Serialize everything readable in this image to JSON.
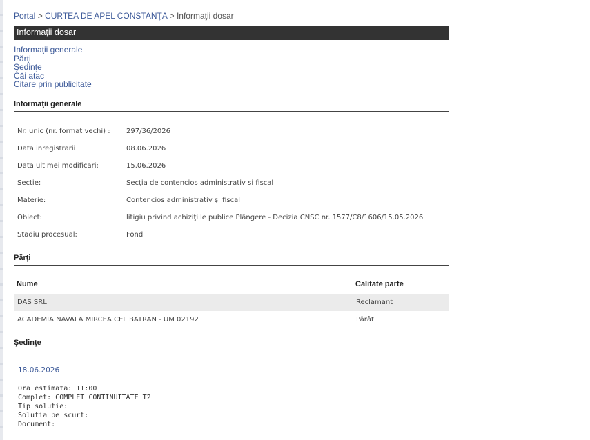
{
  "breadcrumb": {
    "portal": "Portal",
    "sep1": ">",
    "court": "CURTEA DE APEL CONSTANŢA",
    "sep2": ">",
    "current": "Informaţii dosar"
  },
  "title_bar": "Informaţii dosar",
  "nav": [
    "Informaţii generale",
    "Părţi",
    "Şedinţe",
    "Căi atac",
    "Citare prin publicitate"
  ],
  "sections": {
    "general": "Informaţii generale",
    "parti": "Părţi",
    "sedinte": "Şedinţe"
  },
  "general_info": [
    {
      "label": "Nr. unic (nr. format vechi) :",
      "value": "297/36/2026"
    },
    {
      "label": "Data inregistrarii",
      "value": "08.06.2026"
    },
    {
      "label": "Data ultimei modificari:",
      "value": "15.06.2026"
    },
    {
      "label": "Sectie:",
      "value": "Secţia de contencios administrativ si fiscal"
    },
    {
      "label": "Materie:",
      "value": "Contencios administrativ şi fiscal"
    },
    {
      "label": "Obiect:",
      "value": "litigiu privind achiziţiile publice Plângere - Decizia CNSC nr. 1577/C8/1606/15.05.2026"
    },
    {
      "label": "Stadiu procesual:",
      "value": "Fond"
    }
  ],
  "parti": {
    "headers": {
      "name": "Nume",
      "quality": "Calitate parte"
    },
    "rows": [
      {
        "name": "DAS SRL",
        "quality": "Reclamant"
      },
      {
        "name": "ACADEMIA NAVALA MIRCEA CEL BATRAN - UM 02192",
        "quality": "Pârât"
      }
    ]
  },
  "sedinte": {
    "date": "18.06.2026",
    "details": [
      "Ora estimata: 11:00",
      "Complet: COMPLET CONTINUITATE T2",
      "Tip solutie:",
      "Solutia pe scurt:",
      "Document:"
    ]
  }
}
